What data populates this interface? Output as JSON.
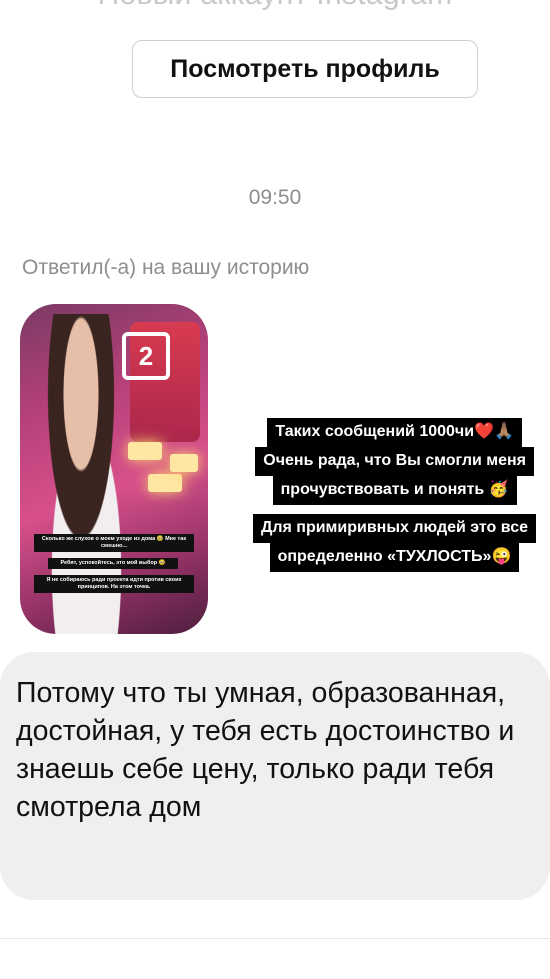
{
  "header": {
    "cut_title": "Новый аккаунт Instagram",
    "view_profile_label": "Посмотреть профиль"
  },
  "thread": {
    "timestamp": "09:50",
    "replied_label": "Ответил(-а) на вашу историю",
    "story": {
      "logo": "2",
      "captions": [
        "Сколько же слухов о моем уходе из дома 🥹 Мне так смешно...",
        "Ребят, успокойтесь, это мой выбор 🥹",
        "Я не собираюсь ради проекта идти против своих принципов. На этом точка."
      ]
    },
    "reply_block_1": [
      "Таких сообщений 1000чи❤️🙏🏽",
      "Очень рада, что Вы смогли меня",
      "прочувствовать и понять 🥳"
    ],
    "reply_block_2": [
      "Для примиривных людей это все",
      "определенно «ТУХЛОСТЬ»😜"
    ],
    "message": "Потому что ты умная, образованная, достойная, у тебя есть достоинство и знаешь себе цену, только ради тебя смотрела дом"
  }
}
